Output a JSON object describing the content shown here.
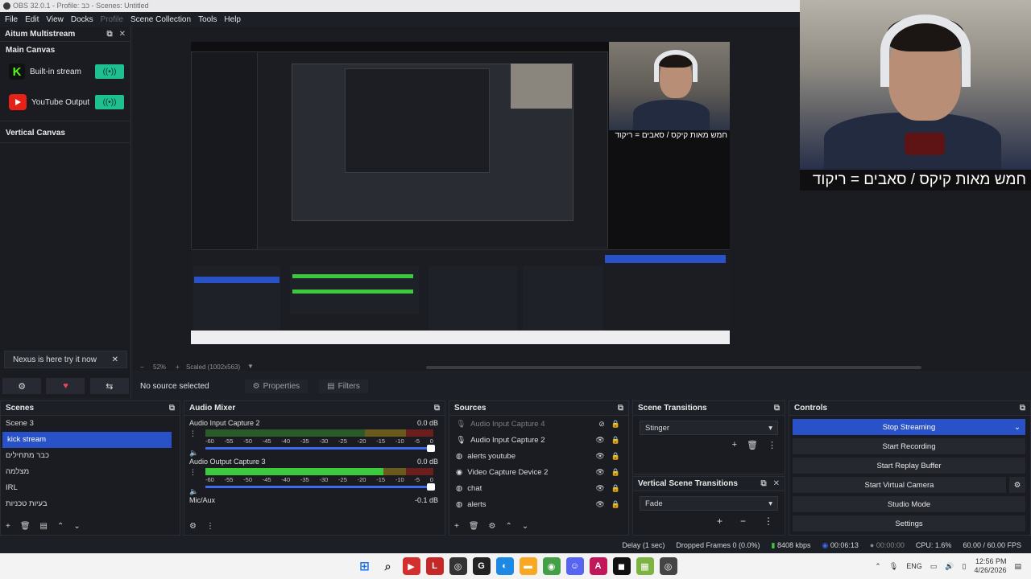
{
  "window": {
    "title": "OBS 32.0.1 - Profile: כב - Scenes: Untitled"
  },
  "menu": [
    "File",
    "Edit",
    "View",
    "Docks",
    "Profile",
    "Scene Collection",
    "Tools",
    "Help"
  ],
  "multistream": {
    "title": "Aitum Multistream",
    "main_canvas": "Main Canvas",
    "outputs": [
      {
        "label": "Built-in stream",
        "icon": "kick-icon"
      },
      {
        "label": "YouTube Output",
        "icon": "youtube-icon"
      }
    ],
    "vertical_canvas": "Vertical Canvas",
    "nexus_notice": "Nexus is here try it now"
  },
  "overlay": {
    "caption": "חמש מאות קיקס / סאבים = ריקוד"
  },
  "preview": {
    "zoom": "52%",
    "scaled": "Scaled (1002x563)"
  },
  "properties_bar": {
    "no_source": "No source selected",
    "properties": "Properties",
    "filters": "Filters"
  },
  "scenes": {
    "title": "Scenes",
    "items": [
      "Scene 3",
      "kick stream",
      "כבר מתחילים",
      "מצלמה",
      "IRL",
      "בעיות טכניות"
    ],
    "selected": "kick stream"
  },
  "audio": {
    "title": "Audio Mixer",
    "ticks": [
      "-60",
      "-55",
      "-50",
      "-45",
      "-40",
      "-35",
      "-30",
      "-25",
      "-20",
      "-15",
      "-10",
      "-5",
      "0"
    ],
    "channels": [
      {
        "name": "Audio Input Capture 2",
        "db": "0.0 dB",
        "level": 0.0
      },
      {
        "name": "Audio Output Capture 3",
        "db": "0.0 dB",
        "level": 0.78
      },
      {
        "name": "Mic/Aux",
        "db": "-0.1 dB",
        "level": 0.0
      }
    ]
  },
  "sources": {
    "title": "Sources",
    "items": [
      {
        "name": "Audio Input Capture 4",
        "dim": true
      },
      {
        "name": "Audio Input Capture 2",
        "dim": false
      },
      {
        "name": "alerts youtube",
        "dim": false
      },
      {
        "name": "Video Capture Device 2",
        "dim": false
      },
      {
        "name": "chat",
        "dim": false
      },
      {
        "name": "alerts",
        "dim": false
      }
    ]
  },
  "transitions": {
    "title": "Scene Transitions",
    "selected": "Stinger",
    "vertical_title": "Vertical Scene Transitions",
    "vertical_selected": "Fade"
  },
  "controls": {
    "title": "Controls",
    "stop_streaming": "Stop Streaming",
    "start_recording": "Start Recording",
    "start_replay": "Start Replay Buffer",
    "start_virtual": "Start Virtual Camera",
    "studio_mode": "Studio Mode",
    "settings": "Settings"
  },
  "status": {
    "delay": "Delay (1 sec)",
    "dropped": "Dropped Frames 0 (0.0%)",
    "kbps": "8408 kbps",
    "stream_time": "00:06:13",
    "rec_time": "00:00:00",
    "cpu": "CPU: 1.6%",
    "fps": "60.00 / 60.00 FPS"
  },
  "taskbar": {
    "lang": "ENG",
    "time": "12:56 PM",
    "date": "4/26/2026"
  },
  "colors": {
    "accent": "#2952c9",
    "live": "#1fbf91",
    "kick": "#53fc18",
    "youtube": "#e62117"
  }
}
